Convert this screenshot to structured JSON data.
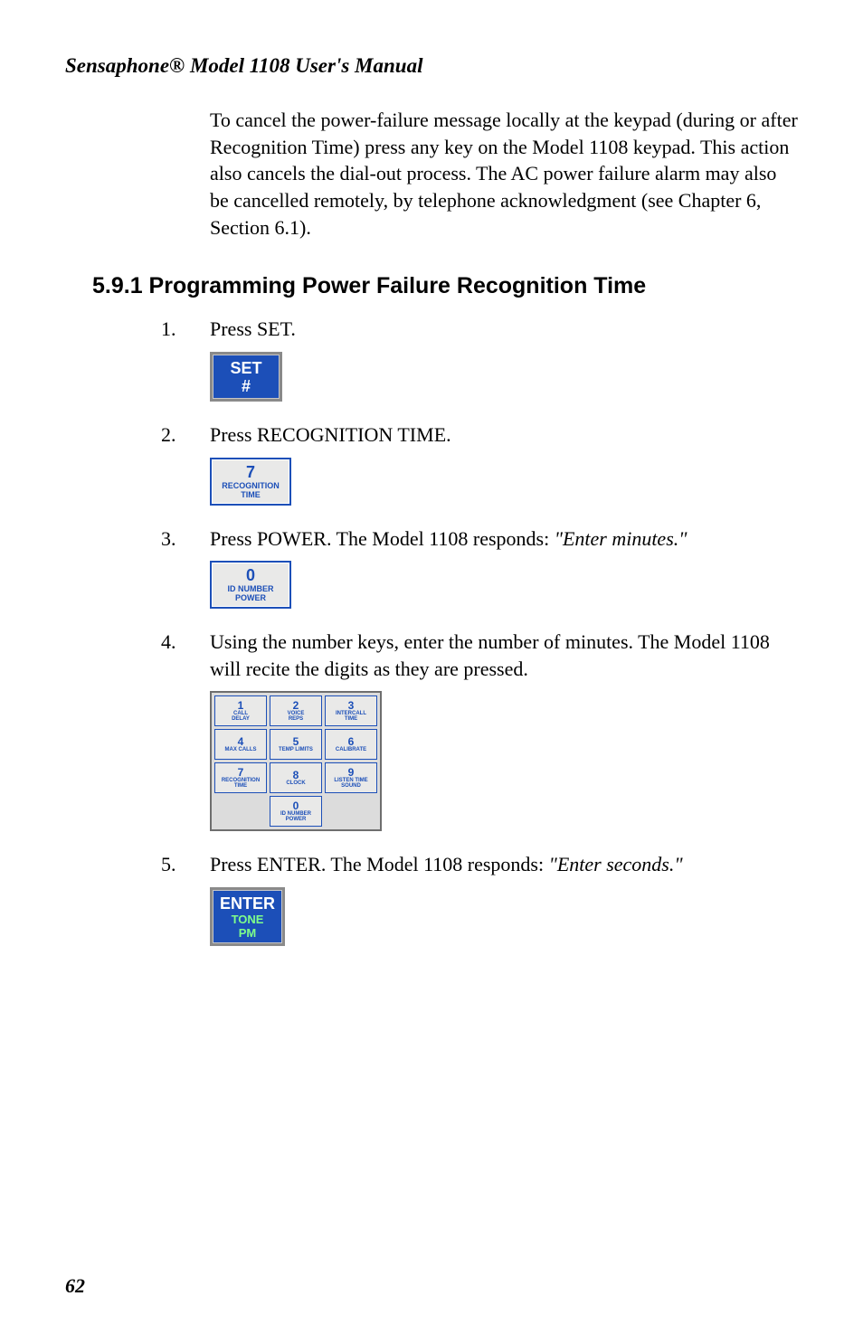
{
  "running_head": "Sensaphone® Model 1108 User's Manual",
  "intro_paragraph": "To cancel the power-failure message locally at the keypad (during or after Recognition Time) press any key on the Model 1108 keypad. This action also cancels the dial-out process. The AC power failure alarm may also be cancelled remotely, by telephone acknowledgment (see Chapter 6, Section 6.1).",
  "section_heading": "5.9.1  Programming Power Failure Recognition Time",
  "steps": [
    {
      "num": "1.",
      "text": "Press SET.",
      "italic_tail": "",
      "key_type": "solid",
      "key": {
        "top": "SET",
        "mid": "#",
        "sub1": "",
        "sub2": ""
      }
    },
    {
      "num": "2.",
      "text": "Press RECOGNITION TIME.",
      "italic_tail": "",
      "key_type": "lg",
      "key": {
        "top": "7",
        "mid": "RECOGNITION",
        "bot": "TIME"
      }
    },
    {
      "num": "3.",
      "text": " Press POWER. The Model 1108 responds: ",
      "italic_tail": "\"Enter minutes.\"",
      "key_type": "lg",
      "key": {
        "top": "0",
        "mid": "ID NUMBER",
        "bot": "POWER"
      }
    },
    {
      "num": "4.",
      "text": "Using the number keys, enter the number of minutes. The Model 1108 will recite the digits as they are pressed.",
      "italic_tail": "",
      "key_type": "keypad"
    },
    {
      "num": "5.",
      "text": "Press ENTER. The Model 1108 responds: ",
      "italic_tail": "\"Enter seconds.\"",
      "key_type": "solid",
      "key": {
        "top": "ENTER",
        "sub1": "TONE",
        "sub2": "PM"
      }
    }
  ],
  "keypad": [
    [
      {
        "n": "1",
        "l1": "CALL",
        "l2": "DELAY"
      },
      {
        "n": "2",
        "l1": "VOICE",
        "l2": "REPS"
      },
      {
        "n": "3",
        "l1": "INTERCALL",
        "l2": "TIME"
      }
    ],
    [
      {
        "n": "4",
        "l1": "MAX CALLS",
        "l2": ""
      },
      {
        "n": "5",
        "l1": "TEMP LIMITS",
        "l2": ""
      },
      {
        "n": "6",
        "l1": "CALIBRATE",
        "l2": ""
      }
    ],
    [
      {
        "n": "7",
        "l1": "RECOGNITION",
        "l2": "TIME"
      },
      {
        "n": "8",
        "l1": "CLOCK",
        "l2": ""
      },
      {
        "n": "9",
        "l1": "LISTEN TIME",
        "l2": "SOUND"
      }
    ],
    [
      {
        "n": "0",
        "l1": "ID NUMBER",
        "l2": "POWER"
      }
    ]
  ],
  "page_number": "62"
}
